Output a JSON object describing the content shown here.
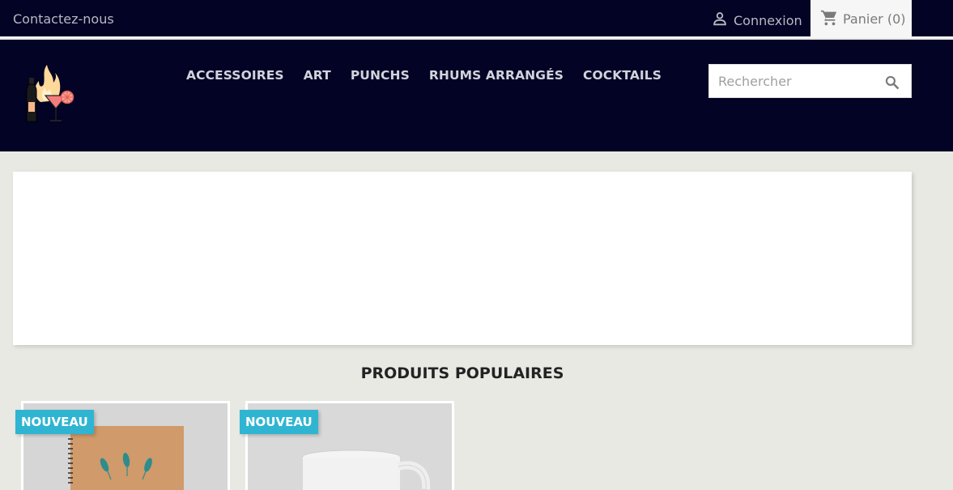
{
  "topbar": {
    "contact_label": "Contactez-nous",
    "login_label": "Connexion",
    "cart_label": "Panier (0)"
  },
  "header": {
    "nav_items": [
      "ACCESSOIRES",
      "ART",
      "PUNCHS",
      "RHUMS ARRANGÉS",
      "COCKTAILS"
    ],
    "search": {
      "placeholder": "Rechercher",
      "value": ""
    }
  },
  "popular": {
    "title": "PRODUITS POPULAIRES",
    "products": [
      {
        "badge": "NOUVEAU"
      },
      {
        "badge": "NOUVEAU"
      }
    ]
  },
  "colors": {
    "header_bg": "#020325",
    "badge_bg": "#2fb5d2",
    "page_bg": "#e9e9e4"
  },
  "icons": [
    "user-icon",
    "cart-icon",
    "search-icon",
    "logo-icon"
  ]
}
